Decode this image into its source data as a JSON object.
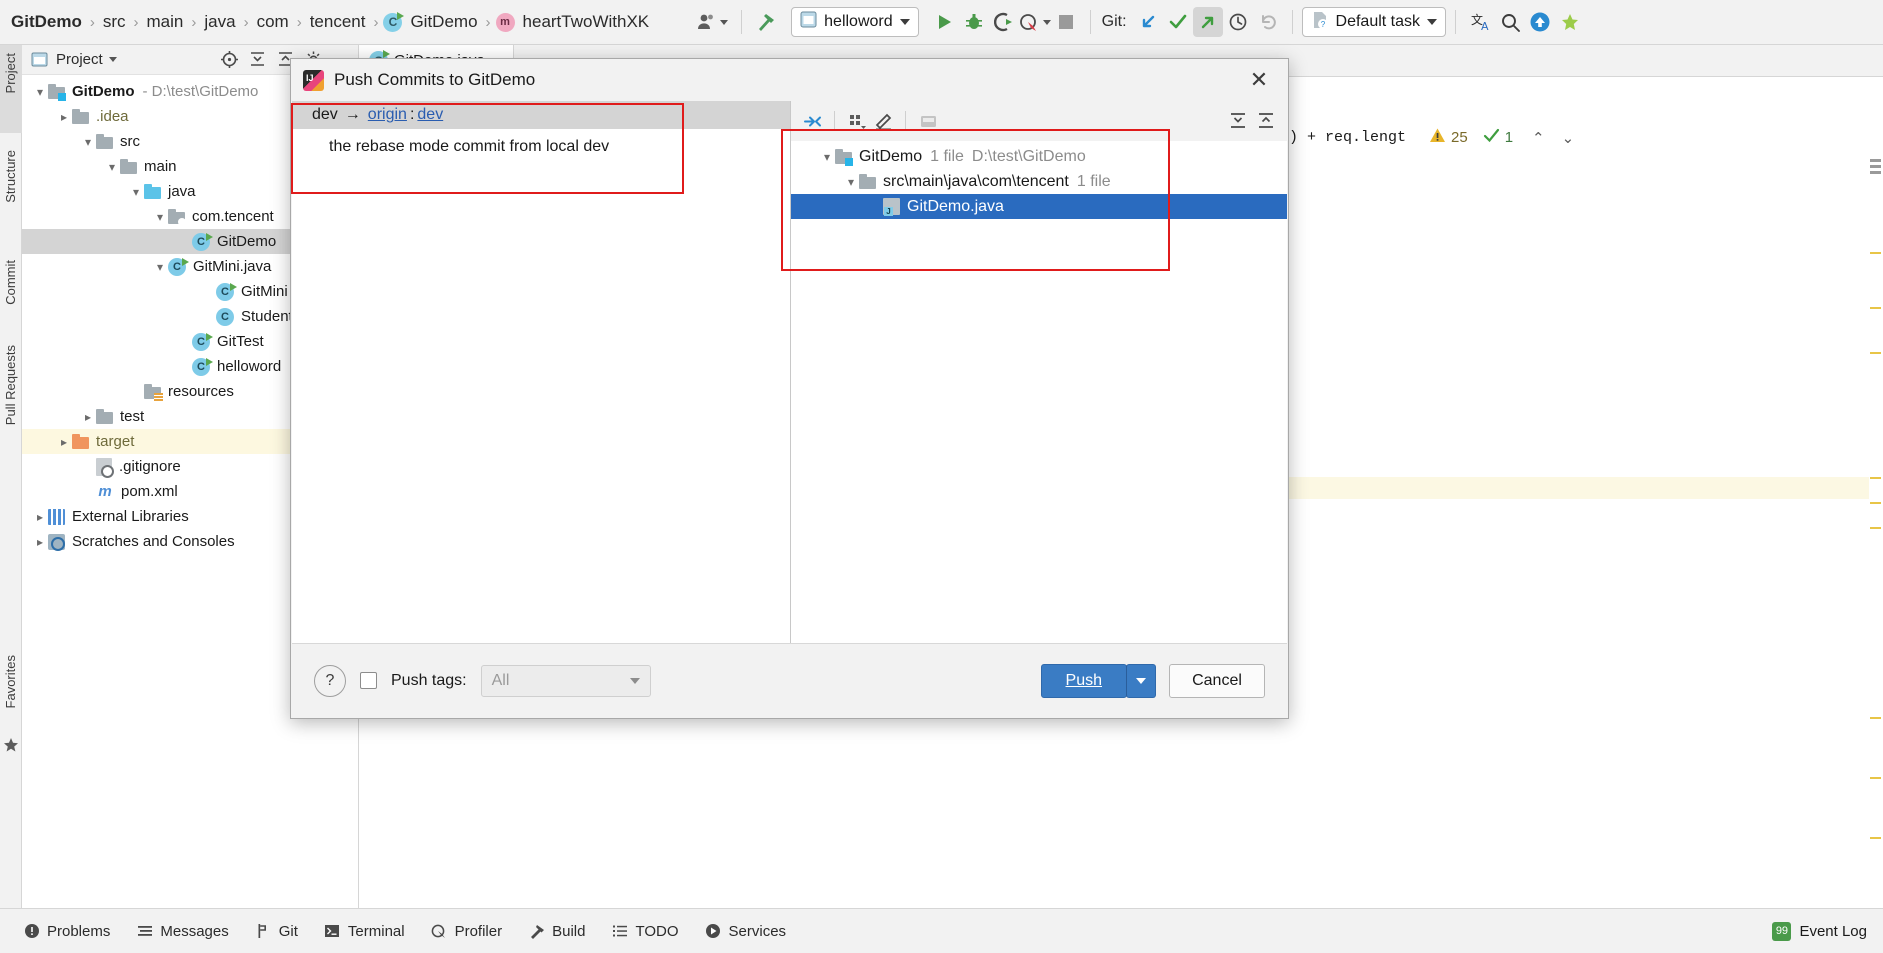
{
  "topbar": {
    "breadcrumbs": [
      {
        "label": "GitDemo",
        "bold": true,
        "icon": null
      },
      {
        "label": "src",
        "bold": false,
        "icon": null
      },
      {
        "label": "main",
        "bold": false,
        "icon": null
      },
      {
        "label": "java",
        "bold": false,
        "icon": null
      },
      {
        "label": "com",
        "bold": false,
        "icon": null
      },
      {
        "label": "tencent",
        "bold": false,
        "icon": null
      },
      {
        "label": "GitDemo",
        "bold": false,
        "icon": "java-class-icon"
      },
      {
        "label": "heartTwoWithXK",
        "bold": false,
        "icon": "method-icon"
      }
    ],
    "separator": "›",
    "profile_icon": "user-icon",
    "hammer_icon": "build-hammer-icon",
    "run_config": "helloword",
    "run_icon": "run-icon",
    "debug_icon": "debug-icon",
    "coverage_icon": "run-with-coverage-icon",
    "profile_icon2": "profiler-icon",
    "stop_icon": "stop-icon",
    "git_label": "Git:",
    "git_update_icon": "git-update-icon",
    "git_commit_icon": "git-commit-checkmark-icon",
    "git_push_icon": "git-push-icon",
    "git_history_icon": "history-icon",
    "git_rollback_icon": "rollback-icon",
    "task_label": "Default task",
    "translate_icon": "translate-icon",
    "search_icon": "search-icon",
    "updates_icon": "update-available-icon"
  },
  "rails": {
    "left": [
      {
        "label": "Project",
        "selected": true
      },
      {
        "label": "Structure",
        "selected": false
      },
      {
        "label": "Commit",
        "selected": false
      },
      {
        "label": "Pull Requests",
        "selected": false
      },
      {
        "label": "Favorites",
        "selected": false
      }
    ]
  },
  "project_panel": {
    "title": "Project",
    "view_icon": "project-view-icon",
    "toolbar_icons": [
      "locate-icon",
      "expand-all-icon",
      "collapse-all-icon",
      "settings-gear-icon",
      "hide-icon"
    ],
    "tree": [
      {
        "indent": 0,
        "arrow": "v",
        "icon": "module-folder-icon",
        "label": "GitDemo",
        "bold": true,
        "suffix": "- D:\\test\\GitDemo",
        "row": "normal"
      },
      {
        "indent": 1,
        "arrow": ">",
        "icon": "folder-icon",
        "label": ".idea",
        "bold": false,
        "suffix": "",
        "row": "normal"
      },
      {
        "indent": 1,
        "arrow": "v",
        "icon": "folder-icon",
        "label": "src",
        "bold": false,
        "suffix": "",
        "row": "normal"
      },
      {
        "indent": 2,
        "arrow": "v",
        "icon": "folder-icon",
        "label": "main",
        "bold": false,
        "suffix": "",
        "row": "normal"
      },
      {
        "indent": 3,
        "arrow": "v",
        "icon": "source-folder-icon",
        "label": "java",
        "bold": false,
        "suffix": "",
        "row": "normal"
      },
      {
        "indent": 4,
        "arrow": "v",
        "icon": "package-icon",
        "label": "com.tencent",
        "bold": false,
        "suffix": "",
        "row": "normal"
      },
      {
        "indent": 5,
        "arrow": "",
        "icon": "java-class-icon",
        "label": "GitDemo",
        "bold": false,
        "suffix": "",
        "row": "selected"
      },
      {
        "indent": 5,
        "arrow": "v",
        "icon": "java-class-icon",
        "label": "GitMini.java",
        "bold": false,
        "suffix": "",
        "row": "normal"
      },
      {
        "indent": 6,
        "arrow": "",
        "icon": "java-class-icon",
        "label": "GitMini",
        "bold": false,
        "suffix": "",
        "row": "normal"
      },
      {
        "indent": 6,
        "arrow": "",
        "icon": "java-class-plain-icon",
        "label": "Student",
        "bold": false,
        "suffix": "",
        "row": "normal"
      },
      {
        "indent": 5,
        "arrow": "",
        "icon": "java-class-icon",
        "label": "GitTest",
        "bold": false,
        "suffix": "",
        "row": "normal"
      },
      {
        "indent": 5,
        "arrow": "",
        "icon": "java-class-icon",
        "label": "helloword",
        "bold": false,
        "suffix": "",
        "row": "normal"
      },
      {
        "indent": 3,
        "arrow": "",
        "icon": "resources-folder-icon",
        "label": "resources",
        "bold": false,
        "suffix": "",
        "row": "normal"
      },
      {
        "indent": 2,
        "arrow": ">",
        "icon": "folder-icon",
        "label": "test",
        "bold": false,
        "suffix": "",
        "row": "normal"
      },
      {
        "indent": 1,
        "arrow": ">",
        "icon": "excluded-folder-icon",
        "label": "target",
        "bold": false,
        "suffix": "",
        "row": "highlight"
      },
      {
        "indent": 1,
        "arrow": "",
        "icon": "gitignore-file-icon",
        "label": ".gitignore",
        "bold": false,
        "suffix": "",
        "row": "normal"
      },
      {
        "indent": 1,
        "arrow": "",
        "icon": "maven-file-icon",
        "label": "pom.xml",
        "bold": false,
        "suffix": "",
        "row": "normal"
      },
      {
        "indent": 0,
        "arrow": ">",
        "icon": "libraries-icon",
        "label": "External Libraries",
        "bold": false,
        "suffix": "",
        "row": "normal"
      },
      {
        "indent": 0,
        "arrow": ">",
        "icon": "scratches-icon",
        "label": "Scratches and Consoles",
        "bold": false,
        "suffix": "",
        "row": "normal"
      }
    ]
  },
  "editor": {
    "tab": {
      "label": "GitDemo.java",
      "icon": "java-class-icon",
      "close": "×"
    },
    "code_fragment": ") + req.lengt",
    "warning_count": "25",
    "warning_icon": "warning-triangle-icon",
    "check_count": "1",
    "check_icon": "green-check-icon",
    "up_arrow": "⌃",
    "down_arrow": "⌄"
  },
  "dialog": {
    "title": "Push Commits to GitDemo",
    "icon": "intellij-idea-icon",
    "close_label": "✕",
    "commits": {
      "branch_source": "dev",
      "branch_arrow": "→",
      "remote": "origin",
      "colon": ":",
      "branch_target": "dev",
      "message": "the  rebase mode commit from local dev"
    },
    "files_toolbar": {
      "collapse_icon": "group-by-directory-icon",
      "group_icon": "group-by-icon",
      "edit_icon": "edit-source-icon",
      "preview_icon": "preview-diff-icon",
      "expand_all_icon": "expand-all-icon",
      "collapse_all_icon": "collapse-all-icon"
    },
    "files_tree": [
      {
        "indent": 0,
        "arrow": "v",
        "icon": "module-folder-icon",
        "label": "GitDemo",
        "count": "1 file",
        "path": "D:\\test\\GitDemo",
        "selected": false
      },
      {
        "indent": 1,
        "arrow": "v",
        "icon": "folder-icon",
        "label": "src\\main\\java\\com\\tencent",
        "count": "1 file",
        "path": "",
        "selected": false
      },
      {
        "indent": 2,
        "arrow": "",
        "icon": "java-file-icon",
        "label": "GitDemo.java",
        "count": "",
        "path": "",
        "selected": true
      }
    ],
    "footer": {
      "help_label": "?",
      "push_tags_checked": false,
      "push_tags_label": "Push tags:",
      "tags_value": "All",
      "push_label": "Push",
      "push_split_caret": "▾",
      "cancel_label": "Cancel"
    }
  },
  "status_bar": {
    "items": [
      {
        "label": "Problems",
        "icon": "problems-icon"
      },
      {
        "label": "Messages",
        "icon": "messages-icon"
      },
      {
        "label": "Git",
        "icon": "git-branch-icon"
      },
      {
        "label": "Terminal",
        "icon": "terminal-icon"
      },
      {
        "label": "Profiler",
        "icon": "profiler-icon"
      },
      {
        "label": "Build",
        "icon": "build-hammer-icon"
      },
      {
        "label": "TODO",
        "icon": "todo-icon"
      },
      {
        "label": "Services",
        "icon": "services-icon"
      }
    ],
    "event_log": {
      "label": "Event Log",
      "badge": "99"
    }
  },
  "colors": {
    "accent_blue": "#2a6bbf",
    "button_blue": "#3a7cc4",
    "annotation_red": "#e01b1b",
    "link_blue": "#2a5db0",
    "highlight_yellow": "#fdf8e0"
  }
}
